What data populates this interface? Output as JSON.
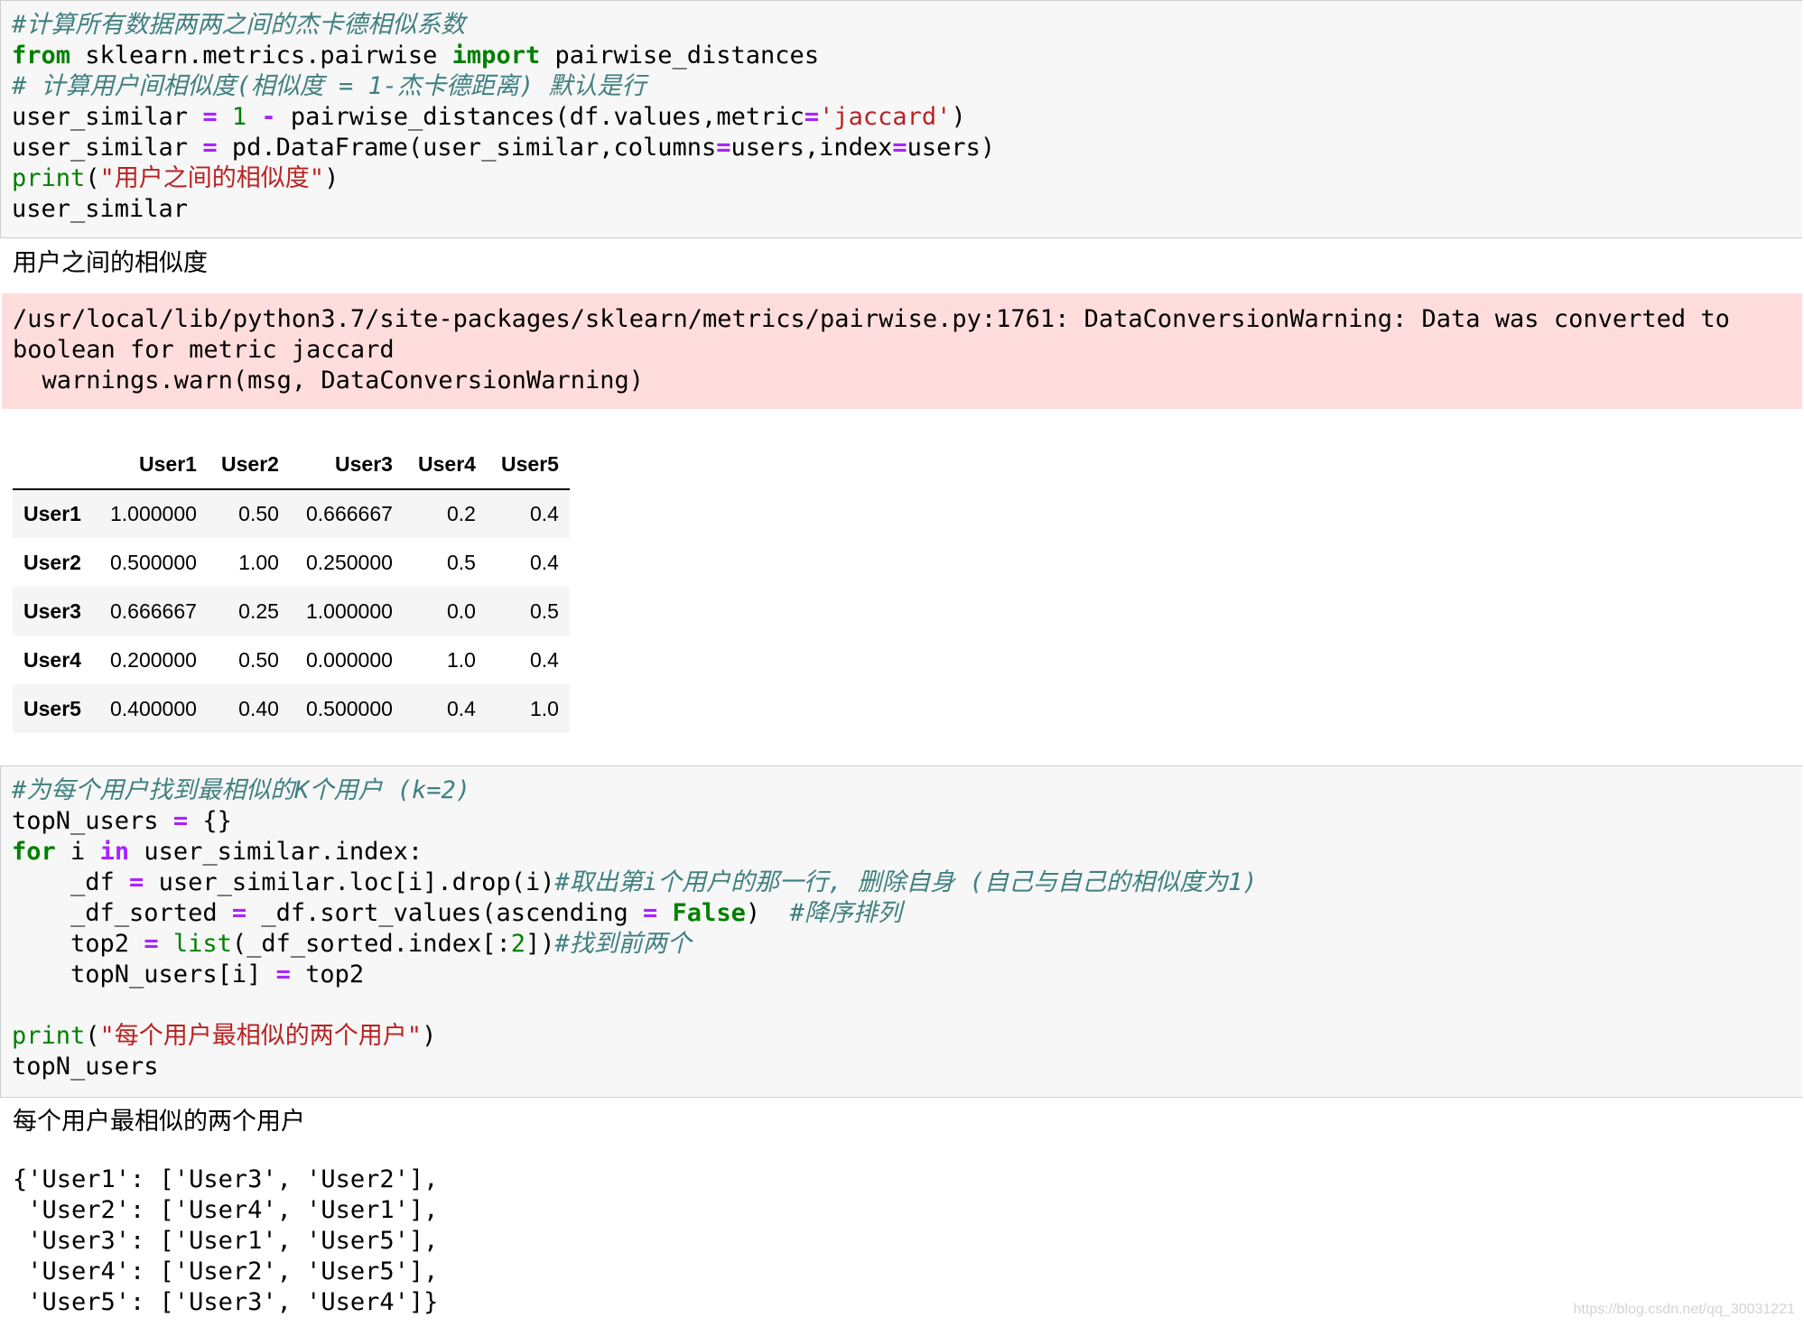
{
  "cell1": {
    "lines": [
      [
        {
          "t": "cm",
          "v": "#计算所有数据两两之间的杰卡德相似系数"
        }
      ],
      [
        {
          "t": "kw",
          "v": "from"
        },
        {
          "t": "",
          "v": " sklearn.metrics.pairwise "
        },
        {
          "t": "kw",
          "v": "import"
        },
        {
          "t": "",
          "v": " pairwise_distances"
        }
      ],
      [
        {
          "t": "cm",
          "v": "# 计算用户间相似度(相似度 = 1-杰卡德距离) 默认是行"
        }
      ],
      [
        {
          "t": "",
          "v": "user_similar "
        },
        {
          "t": "op",
          "v": "="
        },
        {
          "t": "",
          "v": " "
        },
        {
          "t": "num",
          "v": "1"
        },
        {
          "t": "",
          "v": " "
        },
        {
          "t": "op",
          "v": "-"
        },
        {
          "t": "",
          "v": " pairwise_distances(df.values,metric"
        },
        {
          "t": "op",
          "v": "="
        },
        {
          "t": "str",
          "v": "'jaccard'"
        },
        {
          "t": "",
          "v": ")"
        }
      ],
      [
        {
          "t": "",
          "v": "user_similar "
        },
        {
          "t": "op",
          "v": "="
        },
        {
          "t": "",
          "v": " pd.DataFrame(user_similar,columns"
        },
        {
          "t": "op",
          "v": "="
        },
        {
          "t": "",
          "v": "users,index"
        },
        {
          "t": "op",
          "v": "="
        },
        {
          "t": "",
          "v": "users)"
        }
      ],
      [
        {
          "t": "bi",
          "v": "print"
        },
        {
          "t": "",
          "v": "("
        },
        {
          "t": "str",
          "v": "\"用户之间的相似度\""
        },
        {
          "t": "",
          "v": ")"
        }
      ],
      [
        {
          "t": "",
          "v": "user_similar"
        }
      ]
    ]
  },
  "output1": {
    "text": "用户之间的相似度",
    "warning": "/usr/local/lib/python3.7/site-packages/sklearn/metrics/pairwise.py:1761: DataConversionWarning: Data was converted to\nboolean for metric jaccard\n  warnings.warn(msg, DataConversionWarning)"
  },
  "table": {
    "columns": [
      "User1",
      "User2",
      "User3",
      "User4",
      "User5"
    ],
    "rows": [
      {
        "index": "User1",
        "values": [
          "1.000000",
          "0.50",
          "0.666667",
          "0.2",
          "0.4"
        ]
      },
      {
        "index": "User2",
        "values": [
          "0.500000",
          "1.00",
          "0.250000",
          "0.5",
          "0.4"
        ]
      },
      {
        "index": "User3",
        "values": [
          "0.666667",
          "0.25",
          "1.000000",
          "0.0",
          "0.5"
        ]
      },
      {
        "index": "User4",
        "values": [
          "0.200000",
          "0.50",
          "0.000000",
          "1.0",
          "0.4"
        ]
      },
      {
        "index": "User5",
        "values": [
          "0.400000",
          "0.40",
          "0.500000",
          "0.4",
          "1.0"
        ]
      }
    ]
  },
  "cell2": {
    "lines": [
      [
        {
          "t": "cm",
          "v": "#为每个用户找到最相似的K个用户 (k=2)"
        }
      ],
      [
        {
          "t": "",
          "v": "topN_users "
        },
        {
          "t": "op",
          "v": "="
        },
        {
          "t": "",
          "v": " {}"
        }
      ],
      [
        {
          "t": "kw",
          "v": "for"
        },
        {
          "t": "",
          "v": " i "
        },
        {
          "t": "op",
          "v": "in"
        },
        {
          "t": "",
          "v": " user_similar.index:"
        }
      ],
      [
        {
          "t": "",
          "v": "    _df "
        },
        {
          "t": "op",
          "v": "="
        },
        {
          "t": "",
          "v": " user_similar.loc[i].drop(i)"
        },
        {
          "t": "cm",
          "v": "#取出第i个用户的那一行, 删除自身 (自己与自己的相似度为1)"
        }
      ],
      [
        {
          "t": "",
          "v": "    _df_sorted "
        },
        {
          "t": "op",
          "v": "="
        },
        {
          "t": "",
          "v": " _df.sort_values(ascending "
        },
        {
          "t": "op",
          "v": "="
        },
        {
          "t": "",
          "v": " "
        },
        {
          "t": "kw",
          "v": "False"
        },
        {
          "t": "",
          "v": ")  "
        },
        {
          "t": "cm",
          "v": "#降序排列"
        }
      ],
      [
        {
          "t": "",
          "v": "    top2 "
        },
        {
          "t": "op",
          "v": "="
        },
        {
          "t": "",
          "v": " "
        },
        {
          "t": "bi",
          "v": "list"
        },
        {
          "t": "",
          "v": "(_df_sorted.index[:"
        },
        {
          "t": "num",
          "v": "2"
        },
        {
          "t": "",
          "v": "])"
        },
        {
          "t": "cm",
          "v": "#找到前两个"
        }
      ],
      [
        {
          "t": "",
          "v": "    topN_users[i] "
        },
        {
          "t": "op",
          "v": "="
        },
        {
          "t": "",
          "v": " top2"
        }
      ],
      [
        {
          "t": "",
          "v": ""
        }
      ],
      [
        {
          "t": "bi",
          "v": "print"
        },
        {
          "t": "",
          "v": "("
        },
        {
          "t": "str",
          "v": "\"每个用户最相似的两个用户\""
        },
        {
          "t": "",
          "v": ")"
        }
      ],
      [
        {
          "t": "",
          "v": "topN_users"
        }
      ]
    ]
  },
  "output2": {
    "text": "每个用户最相似的两个用户",
    "result": "{'User1': ['User3', 'User2'],\n 'User2': ['User4', 'User1'],\n 'User3': ['User1', 'User5'],\n 'User4': ['User2', 'User5'],\n 'User5': ['User3', 'User4']}"
  },
  "watermark": "https://blog.csdn.net/qq_30031221"
}
